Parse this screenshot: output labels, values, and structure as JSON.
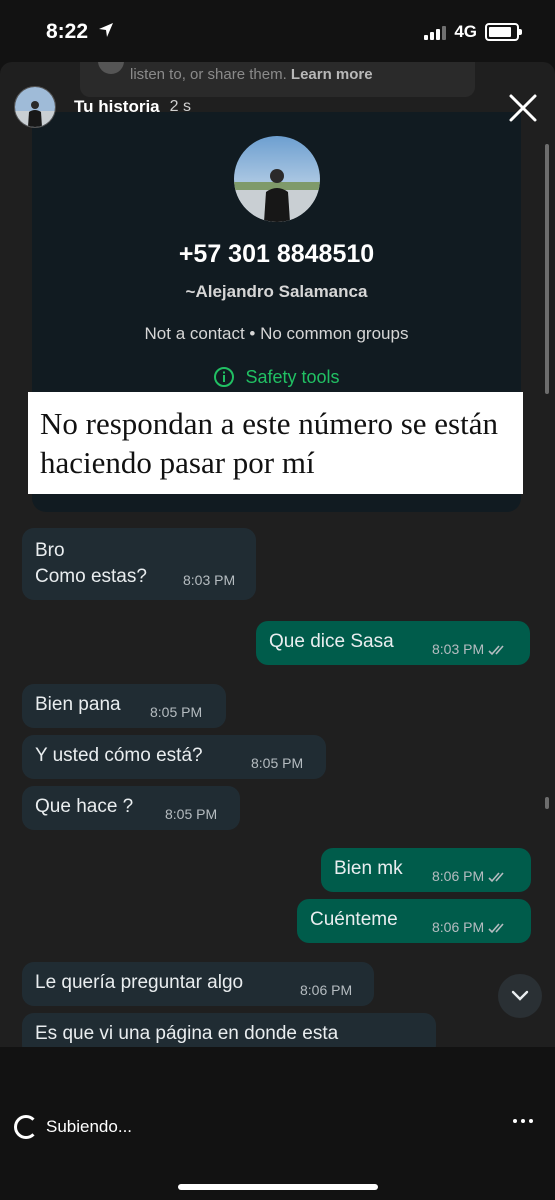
{
  "status_bar": {
    "time": "8:22",
    "network": "4G",
    "location_icon": "location-arrow-icon"
  },
  "banner": {
    "text": "listen to, or share them. ",
    "link": "Learn more"
  },
  "story": {
    "user": "Tu historia",
    "time": "2 s",
    "close_icon": "close-icon"
  },
  "contact_card": {
    "phone": "+57 301 8848510",
    "name": "~Alejandro Salamanca",
    "info": "Not a contact • No common groups",
    "safety": "Safety tools"
  },
  "caption": "No respondan a este número se están haciendo pasar por mí",
  "messages": [
    {
      "dir": "in",
      "text_lines": [
        "Bro",
        "Como estas?"
      ],
      "time": "8:03 PM"
    },
    {
      "dir": "out",
      "text": "Que dice Sasa",
      "time": "8:03 PM"
    },
    {
      "dir": "in",
      "text": "Bien pana",
      "time": "8:05 PM"
    },
    {
      "dir": "in",
      "text": "Y usted cómo está?",
      "time": "8:05 PM"
    },
    {
      "dir": "in",
      "text": "Que hace ?",
      "time": "8:05 PM"
    },
    {
      "dir": "out",
      "text": "Bien mk",
      "time": "8:06 PM"
    },
    {
      "dir": "out",
      "text": "Cuénteme",
      "time": "8:06 PM"
    },
    {
      "dir": "in",
      "text": "Le quería preguntar algo",
      "time": "8:06 PM"
    },
    {
      "dir": "in",
      "text": "Es que vi una página en donde esta",
      "time": ""
    }
  ],
  "bottom": {
    "upload_status": "Subiendo..."
  },
  "colors": {
    "incoming": "#202c33",
    "outgoing": "#005c4b",
    "safety": "#21c063",
    "background": "#1f1f1f"
  }
}
